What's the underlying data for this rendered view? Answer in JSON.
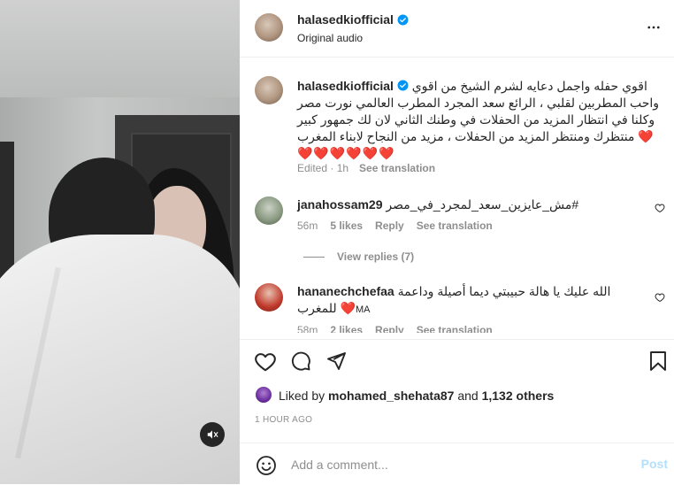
{
  "post": {
    "username": "halasedkiofficial",
    "audio": "Original audio",
    "caption": {
      "username": "halasedkiofficial",
      "line1": "اقوي حفله واجمل دعايه لشرم الشيخ من اقوي",
      "line2": "واحب المطربين لقلبي ، الرائع سعد المجرد المطرب العالمي نورت مصر",
      "line3": "وكلنا في انتظار المزيد من الحفلات في وطنك الثاني لان لك جمهور كبير",
      "line4": "منتظرك ومنتظر المزيد من الحفلات ، مزيد من النجاح لابناء المغرب",
      "hearts": "❤️❤️❤️❤️❤️❤️",
      "heart_inline": "❤️",
      "edited": "Edited · 1h",
      "see_translation": "See translation"
    },
    "comments": [
      {
        "username": "janahossam29",
        "text": "مش_عايزين_سعد_لمجرد_في_مصر#",
        "time": "56m",
        "likes": "5 likes",
        "reply": "Reply",
        "see_translation": "See translation",
        "view_replies": "View replies (7)"
      },
      {
        "username": "hananechchefaa",
        "text_line1": "الله عليك يا هالة حبيبتي ديما أصيلة وداعمة",
        "text_line2": "للمغرب",
        "text_suffix": "MA",
        "heart": "❤️",
        "time": "58m",
        "likes": "2 likes",
        "reply": "Reply",
        "see_translation": "See translation"
      }
    ],
    "liked_by": {
      "prefix": "Liked by ",
      "user": "mohamed_shehata87",
      "and": " and ",
      "others": "1,132 others"
    },
    "timestamp": "1 HOUR AGO",
    "add_comment": {
      "placeholder": "Add a comment...",
      "post_label": "Post"
    }
  },
  "icons": {
    "verified": "verified-badge-icon",
    "more": "more-options-icon",
    "like": "heart-icon",
    "comment": "comment-icon",
    "share": "share-icon",
    "save": "bookmark-icon",
    "emoji": "emoji-icon",
    "mute": "speaker-muted-icon"
  },
  "colors": {
    "verified_blue": "#0095f6",
    "heart_red": "#e0245e",
    "post_disabled": "#b2dffc",
    "secondary_text": "#8e8e8e"
  }
}
